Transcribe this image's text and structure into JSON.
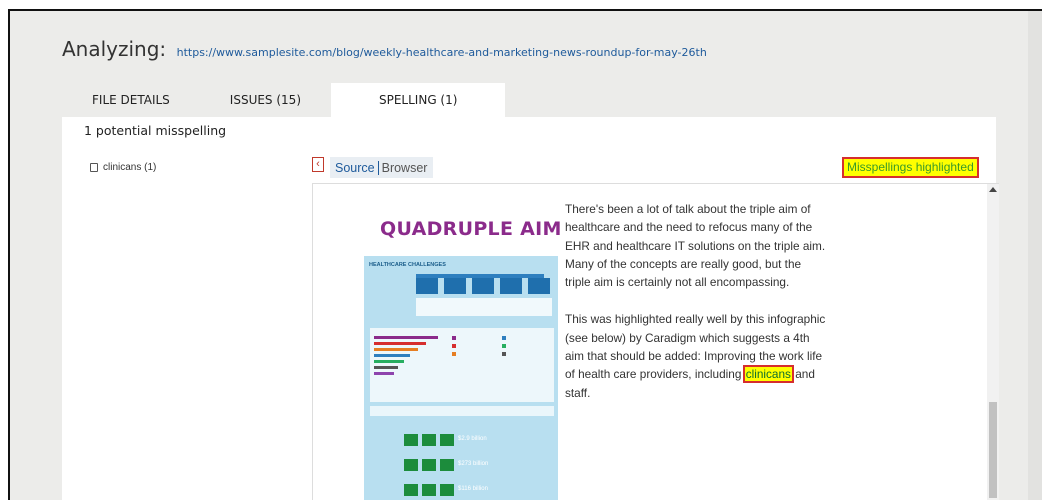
{
  "header": {
    "analyzing_label": "Analyzing:",
    "url": "https://www.samplesite.com/blog/weekly-healthcare-and-marketing-news-roundup-for-may-26th"
  },
  "tabs": [
    {
      "label": "FILE DETAILS",
      "active": false
    },
    {
      "label": "ISSUES (15)",
      "active": false
    },
    {
      "label": "SPELLING (1)",
      "active": true
    }
  ],
  "spelling": {
    "summary": "1 potential misspelling",
    "words": [
      {
        "label": "clinicans (1)"
      }
    ]
  },
  "viewer": {
    "tabs": [
      {
        "label": "Source",
        "active": true
      },
      {
        "label": "Browser",
        "active": false
      }
    ],
    "highlight_badge": "Misspellings highlighted",
    "infographic": {
      "title": "QUADRUPLE AIM",
      "subtitle": "HEALTHCARE CHALLENGES",
      "amounts": [
        "$2.9 billion",
        "$273 billion",
        "$116 billion"
      ]
    },
    "paragraph1": "There's been a lot of talk about the triple aim of healthcare and the need to refocus many of the EHR and healthcare IT solutions on the triple aim. Many of the concepts are really good, but the triple aim is certainly not all encompassing.",
    "paragraph2_pre": "This was highlighted really well by this infographic (see below) by Caradigm which suggests a 4th aim that should be added: Improving the work life of health care providers, including",
    "misspelled_word": "clinicans",
    "paragraph2_post": "and staff."
  },
  "colors": {
    "accent": "#1e5a9b",
    "highlight_fill": "#ffff00",
    "highlight_border": "#d62e2e",
    "highlight_text": "#3a9a28",
    "infographic_title": "#8b2b8b",
    "infographic_bg": "#b8dff0"
  },
  "icons": {
    "word_item": "document-icon",
    "collapse": "chevron-left-icon"
  }
}
